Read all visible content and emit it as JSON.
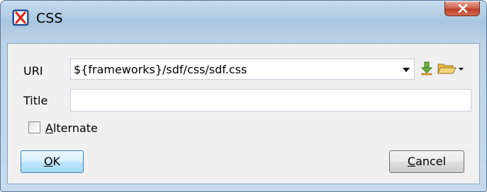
{
  "window": {
    "title": "CSS",
    "close_symbol": "✕"
  },
  "form": {
    "uri_label": "URI",
    "uri_value": "${frameworks}/sdf/css/sdf.css",
    "title_label": "Title",
    "title_value": "",
    "alternate_label_mnemonic": "A",
    "alternate_label_rest": "lternate",
    "alternate_checked": false
  },
  "buttons": {
    "ok_mnemonic": "O",
    "ok_rest": "K",
    "cancel_mnemonic": "C",
    "cancel_rest": "ancel"
  },
  "icons": {
    "app": "app-x-icon",
    "combo_arrow": "dropdown-arrow-icon",
    "download": "download-icon",
    "folder": "open-folder-icon",
    "folder_menu": "dropdown-arrow-icon"
  },
  "colors": {
    "title_gradient_top": "#c6dcee",
    "close_button": "#c0402a",
    "client_bg": "#f0f0f0",
    "default_button_border": "#3c7fb1"
  }
}
